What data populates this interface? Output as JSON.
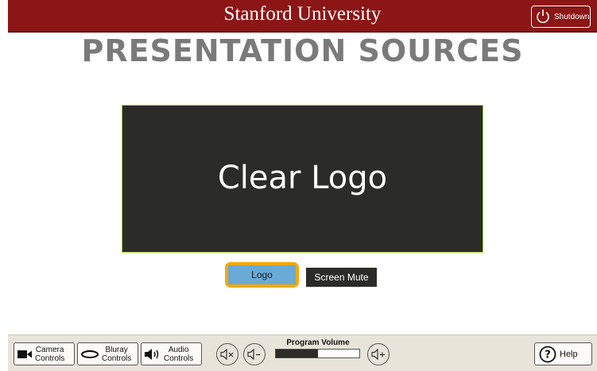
{
  "header": {
    "title": "Stanford University",
    "shutdown_label": "Shutdown"
  },
  "page_title": "PRESENTATION SOURCES",
  "display": {
    "text": "Clear Logo"
  },
  "buttons": {
    "logo": "Logo",
    "screen_mute": "Screen Mute"
  },
  "footer": {
    "camera": {
      "line1": "Camera",
      "line2": "Controls"
    },
    "bluray": {
      "line1": "Bluray",
      "line2": "Controls"
    },
    "audio": {
      "line1": "Audio",
      "line2": "Controls"
    },
    "volume_label": "Program Volume",
    "volume_level": 0.5,
    "help_label": "Help"
  },
  "colors": {
    "brand_red": "#8c1515",
    "highlight": "#f5a800",
    "selected_fill": "#6aaad6",
    "dark": "#2b2b27"
  },
  "icons": [
    "power-icon",
    "camera-icon",
    "bluray-disc-icon",
    "speaker-icon",
    "mute-icon",
    "volume-down-icon",
    "volume-up-icon",
    "help-icon"
  ]
}
